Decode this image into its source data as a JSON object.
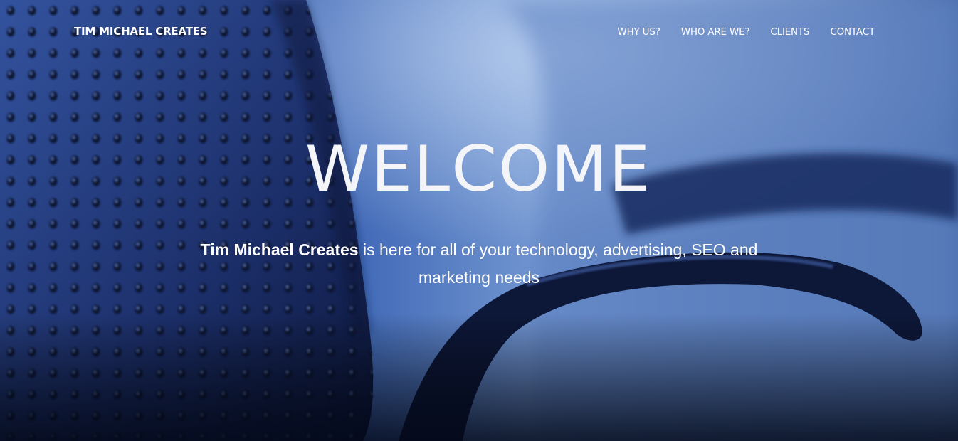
{
  "header": {
    "brand": "TIM MICHAEL CREATES",
    "nav": [
      {
        "label": "WHY US?"
      },
      {
        "label": "WHO ARE WE?"
      },
      {
        "label": "CLIENTS"
      },
      {
        "label": "CONTACT"
      }
    ]
  },
  "hero": {
    "headline": "WELCOME",
    "tagline_bold": "Tim Michael Creates",
    "tagline_rest": " is here for all of your technology, advertising, SEO and marketing needs",
    "background": "blurred-office-chair-photo"
  },
  "colors": {
    "background_blue": "#4a6da8",
    "dark_navy": "#0a1430",
    "text": "#ffffff"
  }
}
